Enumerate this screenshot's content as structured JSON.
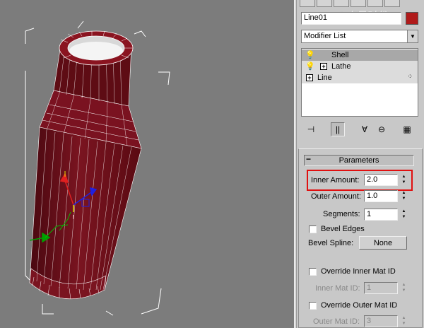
{
  "command_panel": {
    "watermark": "©火星时代",
    "object_name": "Line01",
    "object_color": "#b01a1a",
    "modifier_list_label": "Modifier List",
    "stack": [
      {
        "label": "Shell",
        "selected": true
      },
      {
        "label": "Lathe",
        "expandable": true
      },
      {
        "label": "Line",
        "expandable": true
      }
    ],
    "stack_tools": [
      "pin-stack-icon",
      "show-end-result-icon",
      "make-unique-icon",
      "remove-modifier-icon",
      "configure-sets-icon"
    ]
  },
  "parameters": {
    "rollout_title": "Parameters",
    "collapse_symbol": "−",
    "inner_amount": {
      "label": "Inner Amount:",
      "value": "2.0"
    },
    "outer_amount": {
      "label": "Outer Amount:",
      "value": "1.0"
    },
    "segments": {
      "label": "Segments:",
      "value": "1"
    },
    "bevel_edges": {
      "label": "Bevel Edges",
      "checked": false
    },
    "bevel_spline": {
      "label": "Bevel Spline:",
      "button": "None"
    },
    "override_inner": {
      "label": "Override Inner Mat ID",
      "checked": false
    },
    "inner_mat_id": {
      "label": "Inner Mat ID:",
      "value": "1"
    },
    "override_outer": {
      "label": "Override Outer Mat ID",
      "checked": false
    },
    "outer_mat_id": {
      "label": "Outer Mat ID:",
      "value": "3"
    }
  },
  "colors": {
    "viewport_bg": "#7c7c7c",
    "shell_dark": "#5a0a10",
    "shell_red": "#8a1420",
    "highlight": "#e01010"
  }
}
